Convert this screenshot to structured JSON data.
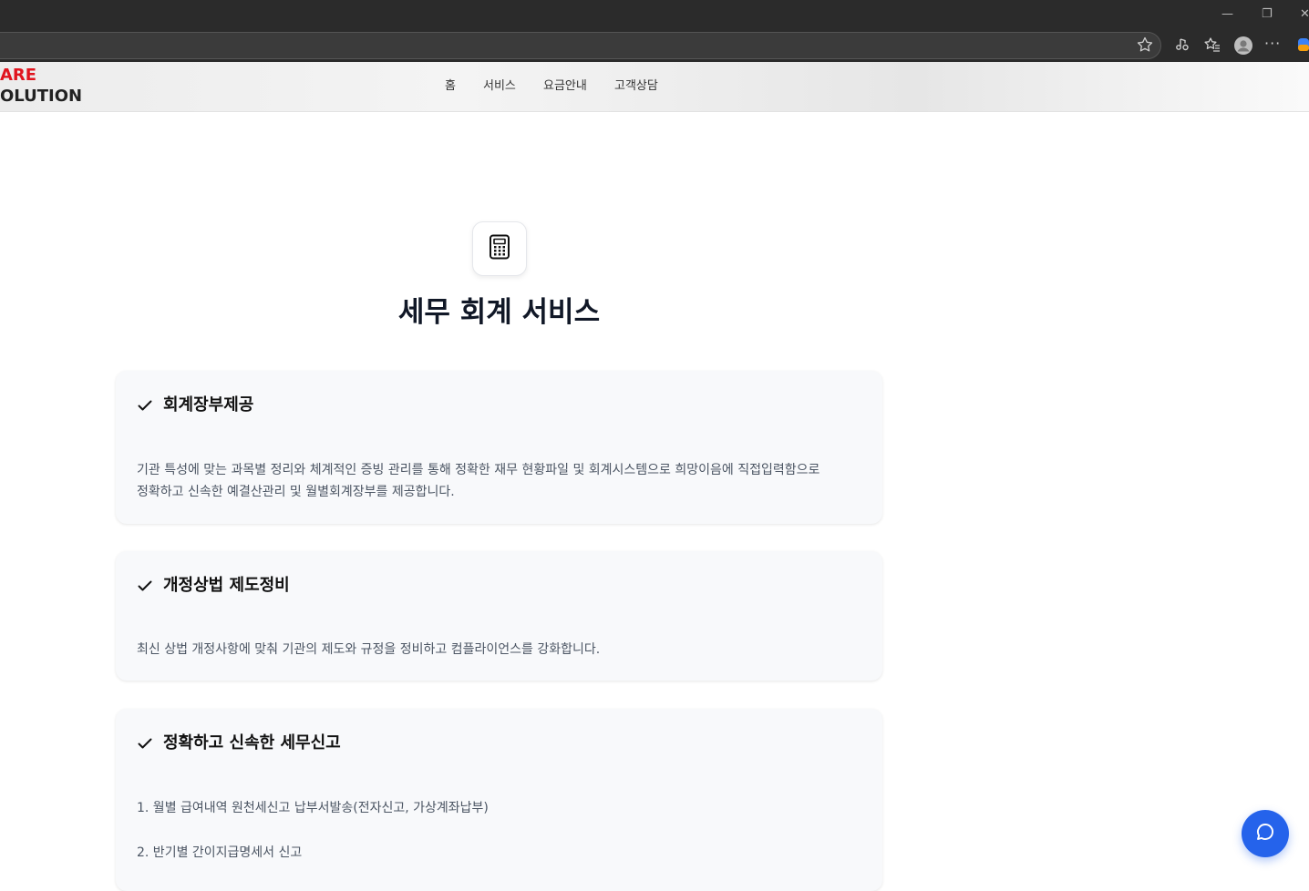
{
  "browser": {
    "window_controls": {
      "minimize": "—",
      "maximize": "❐",
      "close": "✕"
    },
    "toolbar_icons": [
      "star-icon",
      "media-icon",
      "favorites-icon",
      "profile-icon",
      "more-icon",
      "copilot-icon"
    ],
    "more_label": "···"
  },
  "header": {
    "logo_line1": "ARE",
    "logo_line2": "OLUTION",
    "nav": [
      "홈",
      "서비스",
      "요금안내",
      "고객상담"
    ]
  },
  "hero": {
    "icon": "calculator-icon",
    "title": "세무 회계 서비스"
  },
  "cards": [
    {
      "title": "회계장부제공",
      "body": [
        "기관 특성에 맞는 과목별 정리와 체계적인 증빙 관리를 통해 정확한 재무 현황파일 및 회계시스템으로 희망이음에 직접입력함으로",
        "정확하고 신속한 예결산관리 및 월별회계장부를 제공합니다."
      ]
    },
    {
      "title": "개정상법 제도정비",
      "body": [
        "최신 상법 개정사항에 맞춰 기관의 제도와 규정을 정비하고 컴플라이언스를 강화합니다."
      ]
    },
    {
      "title": "정확하고 신속한 세무신고",
      "items": [
        "1. 월별 급여내역 원천세신고 납부서발송(전자신고, 가상계좌납부)",
        "2. 반기별 간이지급명세서 신고"
      ]
    }
  ],
  "colors": {
    "logo_red": "#e0141e",
    "accent_blue": "#2563eb",
    "card_bg": "#f8f9fb"
  }
}
